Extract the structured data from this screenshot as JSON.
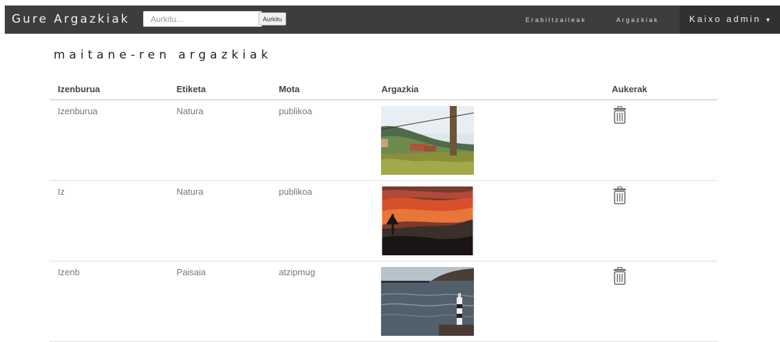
{
  "app": {
    "brand": "Gure Argazkiak",
    "search_placeholder": "Aurkitu...",
    "search_button": "Aurkitu",
    "nav": {
      "users": "Erabiltzaileak",
      "photos": "Argazkiak"
    },
    "user_menu": "Kaixo admin",
    "caret": "▾"
  },
  "page": {
    "title": "maitane-ren argazkiak"
  },
  "table": {
    "headers": [
      "Izenburua",
      "Etiketa",
      "Mota",
      "Argazkia",
      "Aukerak"
    ],
    "rows": [
      {
        "title": "Izenburua",
        "tag": "Natura",
        "type": "publikoa",
        "image": "landscape-fence-photo"
      },
      {
        "title": "Iz",
        "tag": "Natura",
        "type": "publikoa",
        "image": "sunset-photo"
      },
      {
        "title": "Izenb",
        "tag": "Paisaia",
        "type": "atzipmug",
        "image": "lighthouse-sea-photo"
      }
    ]
  },
  "colors": {
    "topbar": "#3d3d3d",
    "user_menu_bg": "#313131"
  },
  "icons": {
    "delete": "trash-icon"
  }
}
